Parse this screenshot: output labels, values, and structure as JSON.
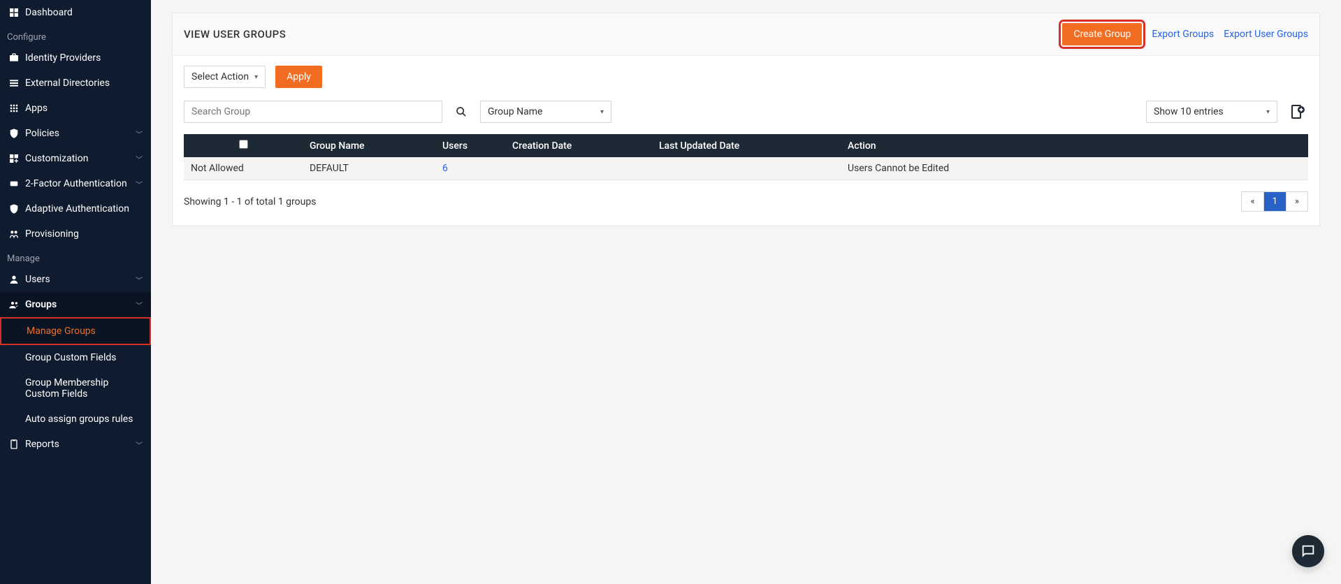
{
  "sidebar": {
    "top": {
      "dashboard": "Dashboard"
    },
    "sections": {
      "configure": "Configure",
      "manage": "Manage"
    },
    "items": {
      "identity_providers": "Identity Providers",
      "external_directories": "External Directories",
      "apps": "Apps",
      "policies": "Policies",
      "customization": "Customization",
      "two_factor": "2-Factor Authentication",
      "adaptive_auth": "Adaptive Authentication",
      "provisioning": "Provisioning",
      "users": "Users",
      "groups": "Groups",
      "reports": "Reports"
    },
    "groups_sub": {
      "manage_groups": "Manage Groups",
      "group_custom_fields": "Group Custom Fields",
      "group_membership_custom_fields": "Group Membership Custom Fields",
      "auto_assign_rules": "Auto assign groups rules"
    }
  },
  "header": {
    "title": "VIEW USER GROUPS",
    "create_group": "Create Group",
    "export_groups": "Export Groups",
    "export_user_groups": "Export User Groups"
  },
  "controls": {
    "select_action_label": "Select Action",
    "apply_label": "Apply",
    "search_placeholder": "Search Group",
    "group_name_label": "Group Name",
    "show_entries_label": "Show 10 entries"
  },
  "table": {
    "columns": {
      "group_name": "Group Name",
      "users": "Users",
      "creation_date": "Creation Date",
      "last_updated": "Last Updated Date",
      "action": "Action"
    },
    "rows": [
      {
        "checkbox_text": "Not Allowed",
        "group_name": "DEFAULT",
        "users": "6",
        "creation_date": "",
        "last_updated": "",
        "action": "Users Cannot be Edited"
      }
    ],
    "footer_text": "Showing 1 - 1 of total 1 groups",
    "pagination": {
      "prev": "«",
      "page": "1",
      "next": "»"
    }
  }
}
